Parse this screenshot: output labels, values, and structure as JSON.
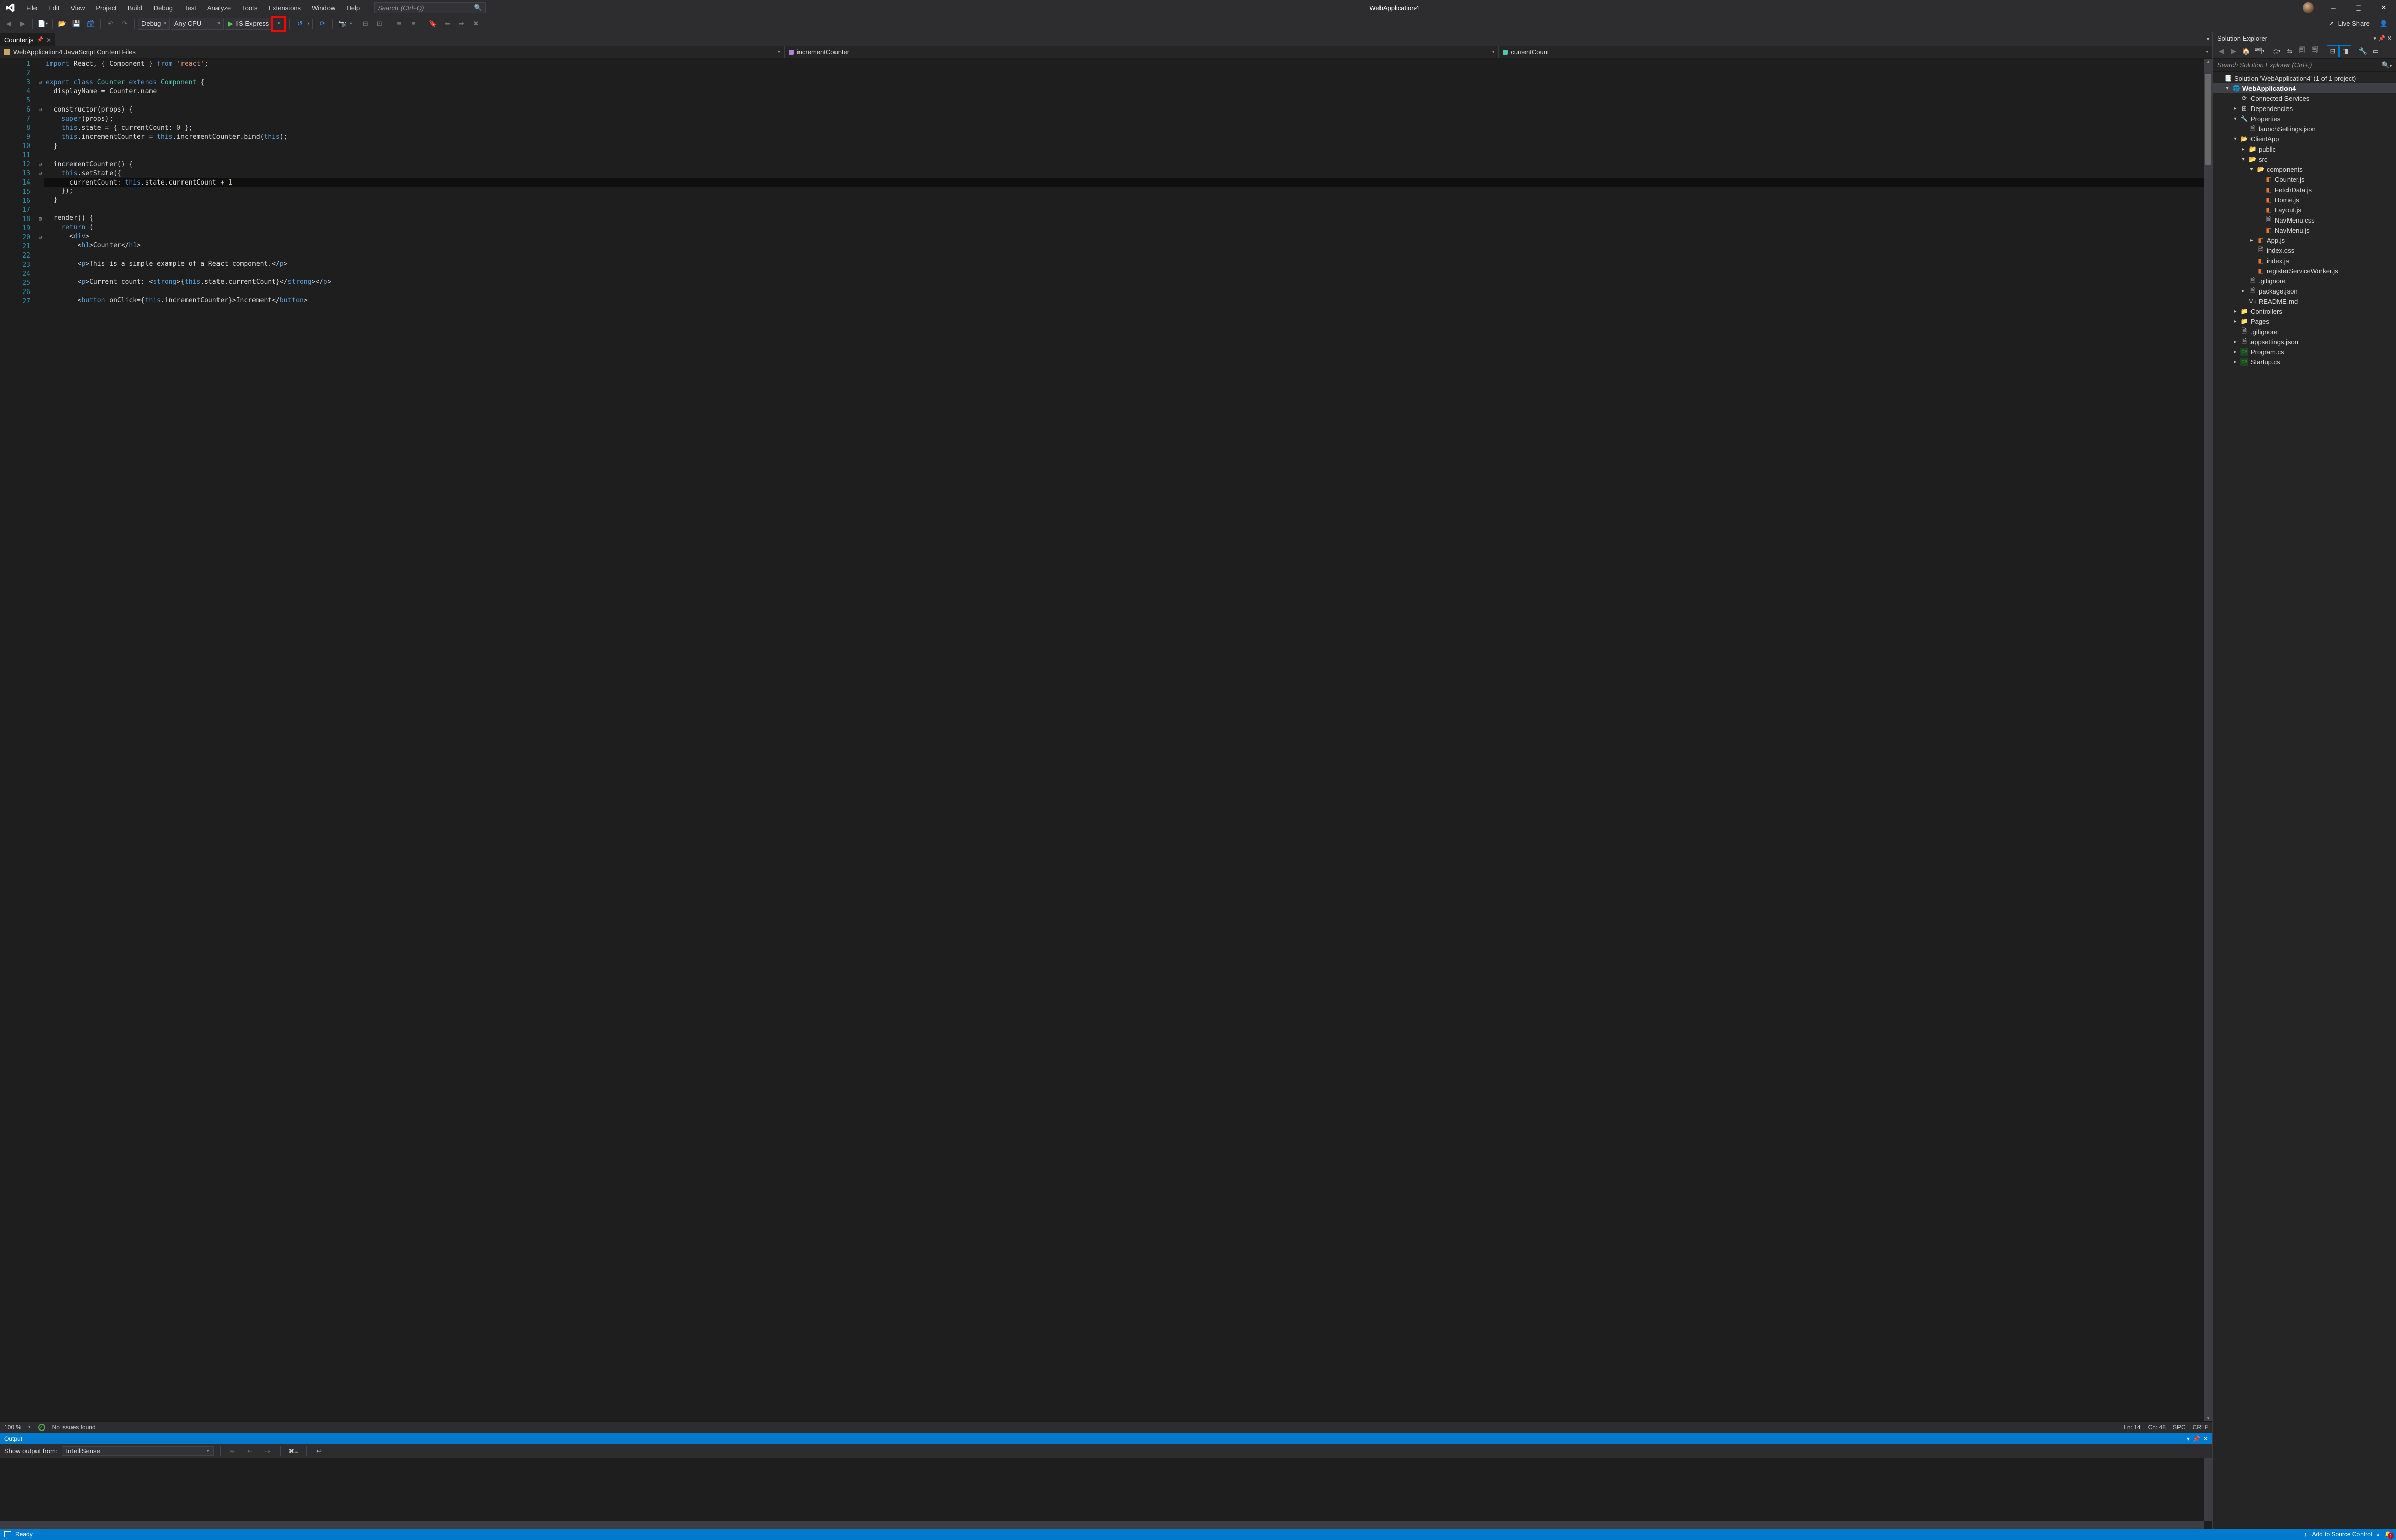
{
  "title": "WebApplication4",
  "menu": [
    "File",
    "Edit",
    "View",
    "Project",
    "Build",
    "Debug",
    "Test",
    "Analyze",
    "Tools",
    "Extensions",
    "Window",
    "Help"
  ],
  "search_placeholder": "Search (Ctrl+Q)",
  "toolbar": {
    "config": "Debug",
    "platform": "Any CPU",
    "start_label": "IIS Express",
    "live_share": "Live Share"
  },
  "tab": {
    "name": "Counter.js"
  },
  "nav": {
    "scope": "WebApplication4 JavaScript Content Files",
    "member": "incrementCounter",
    "field": "currentCount"
  },
  "code_lines": [
    {
      "n": 1,
      "html": "<span class='kw'>import</span> React, { Component } <span class='kw'>from</span> <span class='str'>'react'</span>;"
    },
    {
      "n": 2,
      "html": ""
    },
    {
      "n": 3,
      "fold": "⊟",
      "html": "<span class='kw'>export</span> <span class='kw'>class</span> <span class='type'>Counter</span> <span class='kw'>extends</span> <span class='type'>Component</span> {"
    },
    {
      "n": 4,
      "html": "  displayName = Counter.name"
    },
    {
      "n": 5,
      "html": ""
    },
    {
      "n": 6,
      "fold": "⊟",
      "html": "  constructor(props) {"
    },
    {
      "n": 7,
      "html": "    <span class='kw'>super</span>(props);"
    },
    {
      "n": 8,
      "html": "    <span class='kw'>this</span>.state = { currentCount: <span class='num'>0</span> };"
    },
    {
      "n": 9,
      "html": "    <span class='kw'>this</span>.incrementCounter = <span class='kw'>this</span>.incrementCounter.bind(<span class='kw'>this</span>);"
    },
    {
      "n": 10,
      "html": "  }"
    },
    {
      "n": 11,
      "html": ""
    },
    {
      "n": 12,
      "fold": "⊟",
      "html": "  incrementCounter() {"
    },
    {
      "n": 13,
      "fold": "⊟",
      "html": "    <span class='kw'>this</span>.setState({"
    },
    {
      "n": 14,
      "hl": true,
      "html": "      currentCount: <span class='kw'>this</span>.state.currentCount + <span class='num'>1</span>"
    },
    {
      "n": 15,
      "html": "    });"
    },
    {
      "n": 16,
      "html": "  }"
    },
    {
      "n": 17,
      "html": ""
    },
    {
      "n": 18,
      "fold": "⊟",
      "html": "  render() {"
    },
    {
      "n": 19,
      "html": "    <span class='kw'>return</span> ("
    },
    {
      "n": 20,
      "fold": "⊟",
      "html": "      &lt;<span class='tag'>div</span>&gt;"
    },
    {
      "n": 21,
      "html": "        &lt;<span class='tag'>h1</span>&gt;Counter&lt;/<span class='tag'>h1</span>&gt;"
    },
    {
      "n": 22,
      "html": ""
    },
    {
      "n": 23,
      "html": "        &lt;<span class='tag'>p</span>&gt;This is a simple example of a React component.&lt;/<span class='tag'>p</span>&gt;"
    },
    {
      "n": 24,
      "html": ""
    },
    {
      "n": 25,
      "html": "        &lt;<span class='tag'>p</span>&gt;Current count: &lt;<span class='tag'>strong</span>&gt;{<span class='kw'>this</span>.state.currentCount}&lt;/<span class='tag'>strong</span>&gt;&lt;/<span class='tag'>p</span>&gt;"
    },
    {
      "n": 26,
      "html": ""
    },
    {
      "n": 27,
      "html": "        &lt;<span class='tag'>button</span> onClick={<span class='kw'>this</span>.incrementCounter}&gt;Increment&lt;/<span class='tag'>button</span>&gt;"
    }
  ],
  "editor_status": {
    "zoom": "100 %",
    "issues": "No issues found",
    "ln": "Ln: 14",
    "ch": "Ch: 48",
    "ws": "SPC",
    "eol": "CRLF"
  },
  "output": {
    "title": "Output",
    "from_label": "Show output from:",
    "from_value": "IntelliSense"
  },
  "solution": {
    "title": "Solution Explorer",
    "search_placeholder": "Search Solution Explorer (Ctrl+;)",
    "tree": [
      {
        "d": 0,
        "tw": "",
        "ico": "sol",
        "g": "📑",
        "label": "Solution 'WebApplication4' (1 of 1 project)"
      },
      {
        "d": 1,
        "tw": "▾",
        "ico": "proj",
        "g": "🌐",
        "label": "WebApplication4",
        "sel": true,
        "bold": true
      },
      {
        "d": 2,
        "tw": "",
        "ico": "conn",
        "g": "⟳",
        "label": "Connected Services"
      },
      {
        "d": 2,
        "tw": "▸",
        "ico": "dep",
        "g": "⊞",
        "label": "Dependencies"
      },
      {
        "d": 2,
        "tw": "▾",
        "ico": "wrench",
        "g": "🔧",
        "label": "Properties"
      },
      {
        "d": 3,
        "tw": "",
        "ico": "json",
        "g": "🗎",
        "label": "launchSettings.json"
      },
      {
        "d": 2,
        "tw": "▾",
        "ico": "folder-o",
        "g": "📂",
        "label": "ClientApp"
      },
      {
        "d": 3,
        "tw": "▸",
        "ico": "folder",
        "g": "📁",
        "label": "public"
      },
      {
        "d": 3,
        "tw": "▾",
        "ico": "folder-o",
        "g": "📂",
        "label": "src"
      },
      {
        "d": 4,
        "tw": "▾",
        "ico": "folder-o",
        "g": "📂",
        "label": "components"
      },
      {
        "d": 5,
        "tw": "",
        "ico": "js",
        "g": "◧",
        "label": "Counter.js"
      },
      {
        "d": 5,
        "tw": "",
        "ico": "js",
        "g": "◧",
        "label": "FetchData.js"
      },
      {
        "d": 5,
        "tw": "",
        "ico": "js",
        "g": "◧",
        "label": "Home.js"
      },
      {
        "d": 5,
        "tw": "",
        "ico": "js",
        "g": "◧",
        "label": "Layout.js"
      },
      {
        "d": 5,
        "tw": "",
        "ico": "css",
        "g": "🗎",
        "label": "NavMenu.css"
      },
      {
        "d": 5,
        "tw": "",
        "ico": "js",
        "g": "◧",
        "label": "NavMenu.js"
      },
      {
        "d": 4,
        "tw": "▸",
        "ico": "js",
        "g": "◧",
        "label": "App.js"
      },
      {
        "d": 4,
        "tw": "",
        "ico": "css",
        "g": "🗎",
        "label": "index.css"
      },
      {
        "d": 4,
        "tw": "",
        "ico": "js",
        "g": "◧",
        "label": "index.js"
      },
      {
        "d": 4,
        "tw": "",
        "ico": "js",
        "g": "◧",
        "label": "registerServiceWorker.js"
      },
      {
        "d": 3,
        "tw": "",
        "ico": "git",
        "g": "🗎",
        "label": ".gitignore"
      },
      {
        "d": 3,
        "tw": "▸",
        "ico": "json",
        "g": "🗎",
        "label": "package.json"
      },
      {
        "d": 3,
        "tw": "",
        "ico": "md",
        "g": "M↓",
        "label": "README.md"
      },
      {
        "d": 2,
        "tw": "▸",
        "ico": "folder",
        "g": "📁",
        "label": "Controllers"
      },
      {
        "d": 2,
        "tw": "▸",
        "ico": "folder",
        "g": "📁",
        "label": "Pages"
      },
      {
        "d": 2,
        "tw": "",
        "ico": "git",
        "g": "🗎",
        "label": ".gitignore"
      },
      {
        "d": 2,
        "tw": "▸",
        "ico": "json",
        "g": "🗎",
        "label": "appsettings.json"
      },
      {
        "d": 2,
        "tw": "▸",
        "ico": "cs",
        "g": "C#",
        "label": "Program.cs"
      },
      {
        "d": 2,
        "tw": "▸",
        "ico": "cs",
        "g": "C#",
        "label": "Startup.cs"
      }
    ]
  },
  "statusbar": {
    "ready": "Ready",
    "source_control": "Add to Source Control",
    "notifications": "1"
  }
}
